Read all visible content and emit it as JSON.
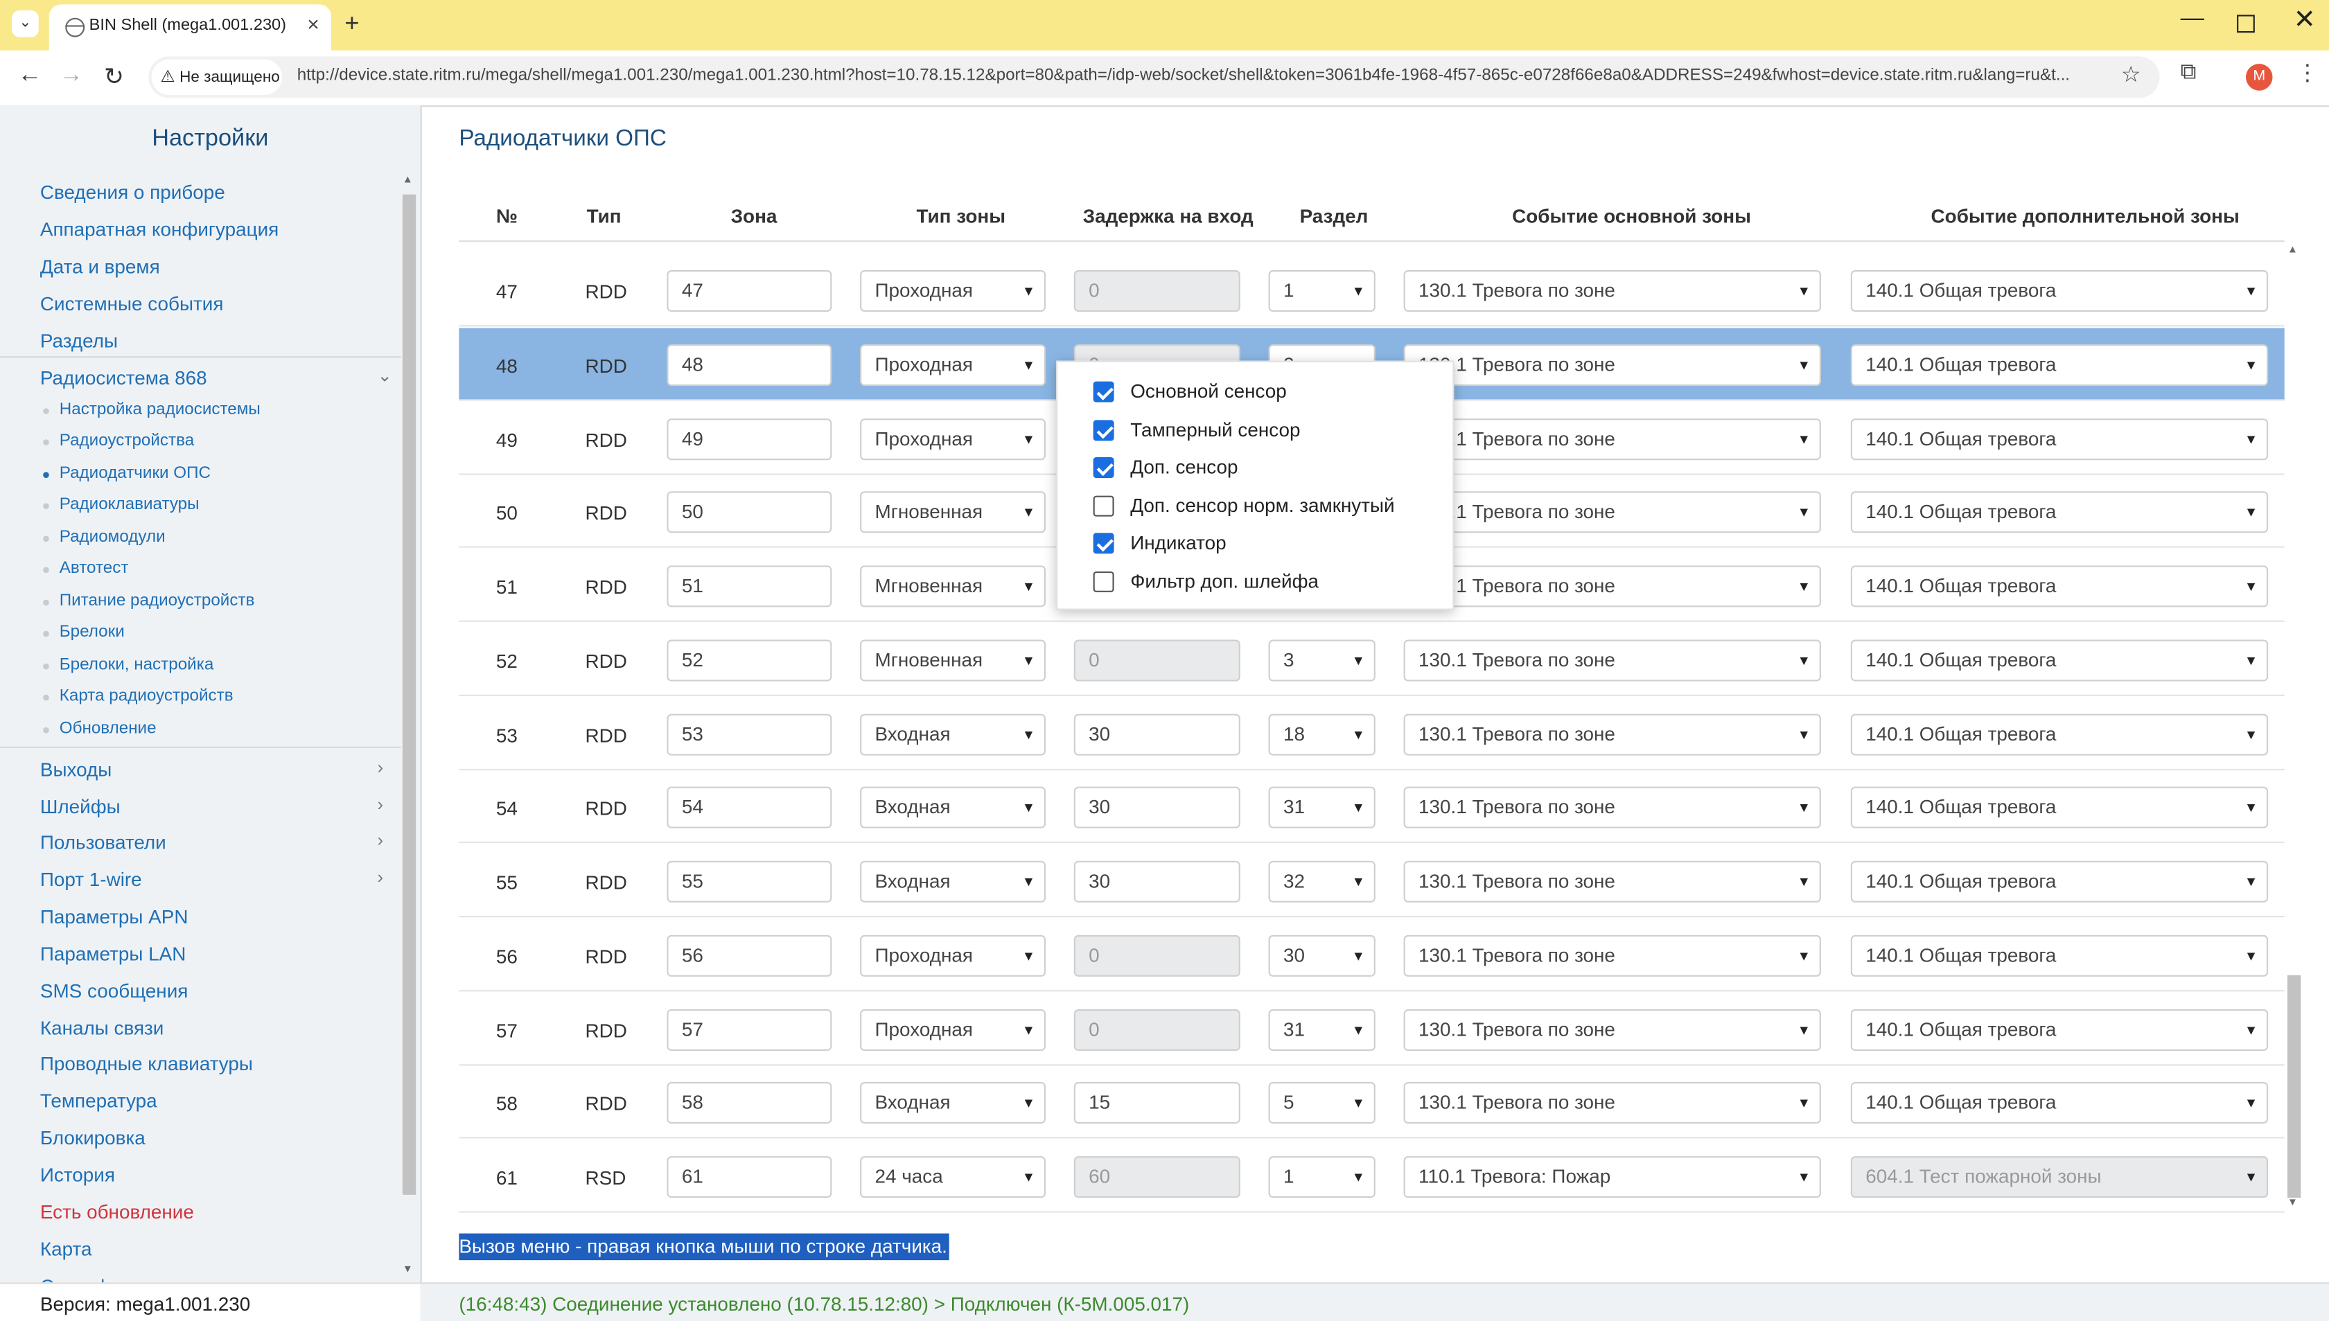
{
  "browser": {
    "tab_title": "BIN Shell (mega1.001.230)",
    "security_label": "Не защищено",
    "url": "http://device.state.ritm.ru/mega/shell/mega1.001.230/mega1.001.230.html?host=10.78.15.12&port=80&path=/idp-web/socket/shell&token=3061b4fe-1968-4f57-865c-e0728f66e8a0&ADDRESS=249&fwhost=device.state.ritm.ru&lang=ru&t...",
    "avatar_letter": "M"
  },
  "sidebar": {
    "title": "Настройки",
    "items": [
      {
        "label": "Сведения о приборе"
      },
      {
        "label": "Аппаратная конфигурация"
      },
      {
        "label": "Дата и время"
      },
      {
        "label": "Системные события"
      },
      {
        "label": "Разделы"
      },
      {
        "label": "Радиосистема 868"
      }
    ],
    "subitems": [
      {
        "label": "Настройка радиосистемы"
      },
      {
        "label": "Радиоустройства"
      },
      {
        "label": "Радиодатчики ОПС",
        "active": true
      },
      {
        "label": "Радиоклавиатуры"
      },
      {
        "label": "Радиомодули"
      },
      {
        "label": "Автотест"
      },
      {
        "label": "Питание радиоустройств"
      },
      {
        "label": "Брелоки"
      },
      {
        "label": "Брелоки, настройка"
      },
      {
        "label": "Карта радиоустройств"
      },
      {
        "label": "Обновление"
      }
    ],
    "items2": [
      {
        "label": "Выходы"
      },
      {
        "label": "Шлейфы"
      },
      {
        "label": "Пользователи"
      },
      {
        "label": "Порт 1-wire"
      },
      {
        "label": "Параметры APN"
      },
      {
        "label": "Параметры LAN"
      },
      {
        "label": "SMS сообщения"
      },
      {
        "label": "Каналы связи"
      },
      {
        "label": "Проводные клавиатуры"
      },
      {
        "label": "Температура"
      },
      {
        "label": "Блокировка"
      },
      {
        "label": "История"
      },
      {
        "label": "Есть обновление"
      },
      {
        "label": "Карта"
      },
      {
        "label": "Сертификаты"
      }
    ],
    "version": "Версия: mega1.001.230"
  },
  "main": {
    "title": "Радиодатчики ОПС",
    "columns": [
      "№",
      "Тип",
      "Зона",
      "Тип зоны",
      "Задержка на вход",
      "Раздел",
      "Событие основной зоны",
      "Событие дополнительной зоны"
    ],
    "rows": [
      {
        "no": "47",
        "type": "RDD",
        "zone": "47",
        "zone_type": "Проходная",
        "delay": "0",
        "delay_disabled": true,
        "section": "1",
        "main_event": "130.1 Тревога по зоне",
        "extra_event": "140.1 Общая тревога"
      },
      {
        "no": "48",
        "type": "RDD",
        "zone": "48",
        "zone_type": "Проходная",
        "delay": "0",
        "delay_disabled": true,
        "section": "2",
        "main_event": "130.1 Тревога по зоне",
        "extra_event": "140.1 Общая тревога",
        "selected": true
      },
      {
        "no": "49",
        "type": "RDD",
        "zone": "49",
        "zone_type": "Проходная",
        "delay": "",
        "delay_disabled": true,
        "section": "",
        "main_event": "130.1 Тревога по зоне",
        "extra_event": "140.1 Общая тревога"
      },
      {
        "no": "50",
        "type": "RDD",
        "zone": "50",
        "zone_type": "Мгновенная",
        "delay": "",
        "delay_disabled": true,
        "section": "",
        "main_event": "130.1 Тревога по зоне",
        "extra_event": "140.1 Общая тревога"
      },
      {
        "no": "51",
        "type": "RDD",
        "zone": "51",
        "zone_type": "Мгновенная",
        "delay": "",
        "delay_disabled": true,
        "section": "",
        "main_event": "130.1 Тревога по зоне",
        "extra_event": "140.1 Общая тревога"
      },
      {
        "no": "52",
        "type": "RDD",
        "zone": "52",
        "zone_type": "Мгновенная",
        "delay": "0",
        "delay_disabled": true,
        "section": "3",
        "main_event": "130.1 Тревога по зоне",
        "extra_event": "140.1 Общая тревога"
      },
      {
        "no": "53",
        "type": "RDD",
        "zone": "53",
        "zone_type": "Входная",
        "delay": "30",
        "delay_disabled": false,
        "section": "18",
        "main_event": "130.1 Тревога по зоне",
        "extra_event": "140.1 Общая тревога"
      },
      {
        "no": "54",
        "type": "RDD",
        "zone": "54",
        "zone_type": "Входная",
        "delay": "30",
        "delay_disabled": false,
        "section": "31",
        "main_event": "130.1 Тревога по зоне",
        "extra_event": "140.1 Общая тревога"
      },
      {
        "no": "55",
        "type": "RDD",
        "zone": "55",
        "zone_type": "Входная",
        "delay": "30",
        "delay_disabled": false,
        "section": "32",
        "main_event": "130.1 Тревога по зоне",
        "extra_event": "140.1 Общая тревога"
      },
      {
        "no": "56",
        "type": "RDD",
        "zone": "56",
        "zone_type": "Проходная",
        "delay": "0",
        "delay_disabled": true,
        "section": "30",
        "main_event": "130.1 Тревога по зоне",
        "extra_event": "140.1 Общая тревога"
      },
      {
        "no": "57",
        "type": "RDD",
        "zone": "57",
        "zone_type": "Проходная",
        "delay": "0",
        "delay_disabled": true,
        "section": "31",
        "main_event": "130.1 Тревога по зоне",
        "extra_event": "140.1 Общая тревога"
      },
      {
        "no": "58",
        "type": "RDD",
        "zone": "58",
        "zone_type": "Входная",
        "delay": "15",
        "delay_disabled": false,
        "section": "5",
        "main_event": "130.1 Тревога по зоне",
        "extra_event": "140.1 Общая тревога"
      },
      {
        "no": "61",
        "type": "RSD",
        "zone": "61",
        "zone_type": "24 часа",
        "delay": "60",
        "delay_disabled": true,
        "section": "1",
        "main_event": "110.1 Тревога: Пожар",
        "extra_event": "604.1 Тест пожарной зоны",
        "extra_disabled": true
      }
    ],
    "hint": "Вызов меню - правая кнопка мыши по строке датчика."
  },
  "context_menu": {
    "items": [
      {
        "label": "Основной сенсор",
        "checked": true
      },
      {
        "label": "Тамперный сенсор",
        "checked": true
      },
      {
        "label": "Доп. сенсор",
        "checked": true
      },
      {
        "label": "Доп. сенсор норм. замкнутый",
        "checked": false
      },
      {
        "label": "Индикатор",
        "checked": true
      },
      {
        "label": "Фильтр доп. шлейфа",
        "checked": false
      }
    ]
  },
  "status": "(16:48:43) Соединение установлено (10.78.15.12:80) > Подключен (К-5М.005.017)"
}
